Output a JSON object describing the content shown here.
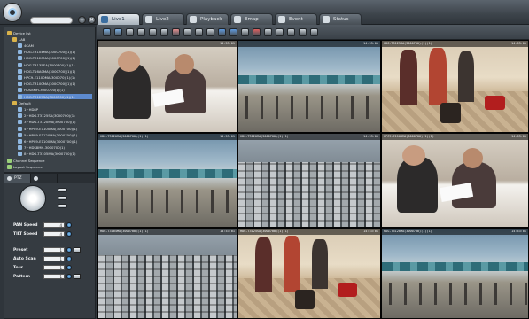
{
  "window": {
    "tabs": [
      {
        "label": "Live1",
        "active": true
      },
      {
        "label": "Live2",
        "active": false
      },
      {
        "label": "Playback",
        "active": false
      },
      {
        "label": "Emap",
        "active": false
      },
      {
        "label": "Event",
        "active": false
      },
      {
        "label": "Status",
        "active": false
      }
    ]
  },
  "tree": {
    "items": [
      {
        "label": "Device list",
        "indent": 0,
        "icon": "folder-icon"
      },
      {
        "label": "LAB",
        "indent": 1,
        "icon": "folder-icon"
      },
      {
        "label": "4CAM",
        "indent": 2,
        "icon": "camera-icon"
      },
      {
        "label": "HDG-T3104MA(3000700)(1)(1)",
        "indent": 2,
        "icon": "camera-icon"
      },
      {
        "label": "HDG-T3120MA(3000700)(1)(1)",
        "indent": 2,
        "icon": "camera-icon"
      },
      {
        "label": "HDG-T3135SA(3000700)(1)(1)",
        "indent": 2,
        "icon": "camera-icon"
      },
      {
        "label": "HDG-T16A0MA(3000700)(1)(1)",
        "indent": 2,
        "icon": "camera-icon"
      },
      {
        "label": "HPC9-E1100MA(300070)(1)(1)",
        "indent": 2,
        "icon": "camera-icon"
      },
      {
        "label": "HDG-T3100MA(3000700)(1)(1)",
        "indent": 2,
        "icon": "camera-icon"
      },
      {
        "label": "HDS8MH-3000700(1)(1)",
        "indent": 2,
        "icon": "camera-icon"
      },
      {
        "label": "HDG-T3125SA(3000700)(1)(1)",
        "indent": 2,
        "icon": "camera-icon",
        "selected": true
      },
      {
        "label": "Default",
        "indent": 1,
        "icon": "folder-icon"
      },
      {
        "label": "1~HD8P",
        "indent": 2,
        "icon": "camera-icon"
      },
      {
        "label": "2~HDG-T3125SA(3000700)(1)",
        "indent": 2,
        "icon": "camera-icon"
      },
      {
        "label": "3~HDG-T3120MA(3000700)(1)",
        "indent": 2,
        "icon": "camera-icon"
      },
      {
        "label": "4~HPC9-E1100MA(3000700)(1)",
        "indent": 2,
        "icon": "camera-icon"
      },
      {
        "label": "5~HPC9-E1120MA(3000700)(1)",
        "indent": 2,
        "icon": "camera-icon"
      },
      {
        "label": "6~HPC9-E1100MA(3000700)(1)",
        "indent": 2,
        "icon": "camera-icon"
      },
      {
        "label": "7~HDS8MH-3000700(1)",
        "indent": 2,
        "icon": "camera-icon"
      },
      {
        "label": "8~HDG-T3105MA(3000700)(1)",
        "indent": 2,
        "icon": "camera-icon"
      },
      {
        "label": "Channel Sequence",
        "indent": 0,
        "icon": "sequence-icon"
      },
      {
        "label": "Layout Sequence",
        "indent": 0,
        "icon": "sequence-icon"
      }
    ]
  },
  "ptz": {
    "tabs": [
      {
        "label": "PTZ",
        "active": true
      },
      {
        "label": "",
        "active": false
      }
    ],
    "pan_speed": {
      "label": "PAN Speed",
      "value": "4"
    },
    "tilt_speed": {
      "label": "TILT Speed",
      "value": "4"
    },
    "preset": {
      "label": "Preset",
      "value": "1"
    },
    "auto_scan": {
      "label": "Auto Scan",
      "value": "1"
    },
    "tour": {
      "label": "Tour",
      "value": "1"
    },
    "pattern": {
      "label": "Pattern",
      "value": "1"
    }
  },
  "cameras": [
    {
      "name": "",
      "time": "14:53:01",
      "scene": "office"
    },
    {
      "name": "",
      "time": "14:53:01",
      "scene": "airport"
    },
    {
      "name": "HDG-T3125SA(3000700)(1)(1)",
      "time": "14:53:01",
      "scene": "baggage"
    },
    {
      "name": "HDG-T3120MA(3000700)(1)(1)",
      "time": "14:53:01",
      "scene": "airport"
    },
    {
      "name": "HDG-T3120MA(3000700)(1)(1)",
      "time": "14:53:01",
      "scene": "highway"
    },
    {
      "name": "HPC9-E1100MA(3000700)(1)(1)",
      "time": "14:53:01",
      "scene": "office"
    },
    {
      "name": "HDG-T3104MA(3000700)(1)(1)",
      "time": "14:53:01",
      "scene": "highway"
    },
    {
      "name": "HDG-T3125SA(3000700)(1)(1)",
      "time": "14:53:01",
      "scene": "baggage"
    },
    {
      "name": "HDG-T3120MA(3000700)(1)(1)",
      "time": "14:53:01",
      "scene": "airport"
    }
  ],
  "colors": {
    "selection": "#5d8bd0",
    "accent": "#2c6aa7"
  }
}
